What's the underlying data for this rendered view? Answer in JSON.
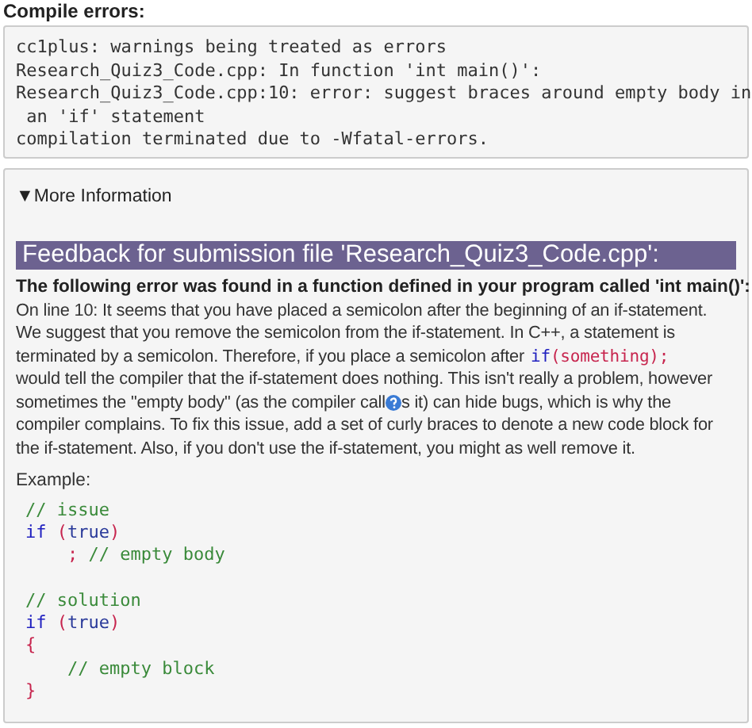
{
  "compile_errors": {
    "heading": "Compile errors:",
    "lines": [
      "cc1plus: warnings being treated as errors",
      "Research_Quiz3_Code.cpp: In function 'int main()':",
      "Research_Quiz3_Code.cpp:10: error: suggest braces around empty body in",
      " an 'if' statement",
      "compilation terminated due to -Wfatal-errors."
    ]
  },
  "more_information": {
    "toggle": "▼More Information",
    "feedback_title": "Feedback for submission file 'Research_Quiz3_Code.cpp':",
    "error_summary": "The following error was found in a function defined in your program called 'int main()':",
    "explanation_lines": [
      [
        {
          "kind": "text",
          "text": "On line 10: It seems that you have placed a semicolon after the beginning of an if-statement."
        }
      ],
      [
        {
          "kind": "text",
          "text": "We suggest that you remove the semicolon from the if-statement. In C++, a statement is"
        }
      ],
      [
        {
          "kind": "text",
          "text": "terminated by a semicolon. Therefore, if you place a semicolon after"
        },
        {
          "kind": "code",
          "tokens": [
            {
              "text": "if",
              "kind": "keyword"
            },
            {
              "text": "(something);",
              "kind": "punct"
            }
          ]
        }
      ],
      [
        {
          "kind": "text",
          "text": "would tell the compiler that the if-statement does nothing. This isn't really a problem, however"
        }
      ],
      [
        {
          "kind": "text",
          "text": "sometimes the \"empty body\" (as the compiler call"
        },
        {
          "kind": "help_icon"
        },
        {
          "kind": "text",
          "text": "s it) can hide bugs, which is why the"
        }
      ],
      [
        {
          "kind": "text",
          "text": "compiler complains. To fix this issue, add a set of curly braces to denote a new code block for"
        }
      ],
      [
        {
          "kind": "text",
          "text": "the if-statement. Also, if you don't use the if-statement, you might as well remove it."
        }
      ]
    ],
    "example_label": "Example:",
    "example_code": [
      [
        [
          {
            "text": "// issue",
            "kind": "comment"
          }
        ],
        [
          {
            "text": "if",
            "kind": "keyword"
          },
          {
            "text": " (",
            "kind": "punct"
          },
          {
            "text": "true",
            "kind": "literal"
          },
          {
            "text": ")",
            "kind": "punct"
          }
        ],
        [
          {
            "text": "    ;",
            "kind": "punct"
          },
          {
            "text": " // empty body",
            "kind": "comment"
          }
        ]
      ],
      [
        [
          {
            "text": "// solution",
            "kind": "comment"
          }
        ],
        [
          {
            "text": "if",
            "kind": "keyword"
          },
          {
            "text": " (",
            "kind": "punct"
          },
          {
            "text": "true",
            "kind": "literal"
          },
          {
            "text": ")",
            "kind": "punct"
          }
        ],
        [
          {
            "text": "{",
            "kind": "punct"
          }
        ],
        [
          {
            "text": "    // empty block",
            "kind": "comment"
          }
        ],
        [
          {
            "text": "}",
            "kind": "punct"
          }
        ]
      ]
    ]
  }
}
